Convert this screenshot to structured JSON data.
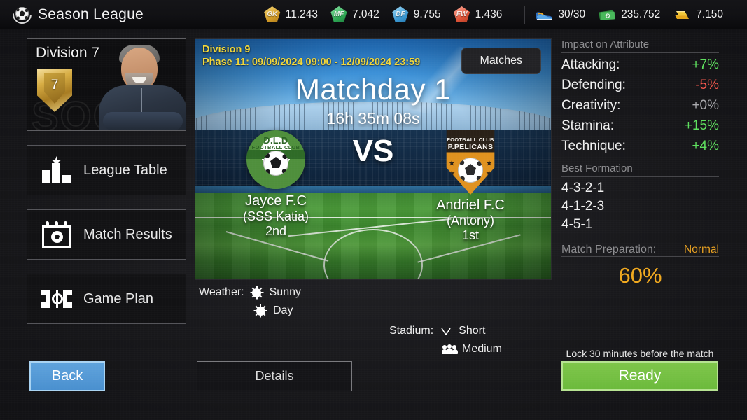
{
  "header": {
    "title": "Season League",
    "logo_icon": "soccer-ball-laurel-icon",
    "currencies": [
      {
        "icon": "gk-token-icon",
        "code": "GK",
        "value": "11.243"
      },
      {
        "icon": "mf-token-icon",
        "code": "MF",
        "value": "7.042"
      },
      {
        "icon": "df-token-icon",
        "code": "DF",
        "value": "9.755"
      },
      {
        "icon": "fw-token-icon",
        "code": "FW",
        "value": "1.436"
      },
      {
        "icon": "energy-shoe-icon",
        "code": "",
        "value": "30/30"
      },
      {
        "icon": "cash-icon",
        "code": "",
        "value": "235.752"
      },
      {
        "icon": "gold-bar-icon",
        "code": "",
        "value": "7.150"
      }
    ]
  },
  "sidebar": {
    "division_card": {
      "title": "Division 7",
      "badge_number": "7",
      "watermark": "SOCCER"
    },
    "items": [
      {
        "label": "League Table",
        "icon": "bar-chart-star-icon"
      },
      {
        "label": "Match Results",
        "icon": "calendar-ball-icon"
      },
      {
        "label": "Game Plan",
        "icon": "pitch-icon"
      }
    ]
  },
  "match": {
    "division": "Division 9",
    "phase": "Phase 11: 09/09/2024 09:00 - 12/09/2024 23:59",
    "matches_button": "Matches",
    "matchday": "Matchday 1",
    "countdown": "16h 35m 08s",
    "vs": "VS",
    "home": {
      "name": "Jayce F.C",
      "manager": "(SSS Katia)",
      "rank": "2nd",
      "crest_icon": "home-crest-icon",
      "crest_line1": "D.L.D",
      "crest_line2": "FOOTBALL CLUB"
    },
    "away": {
      "name": "Andriel F.C",
      "manager": "(Antony)",
      "rank": "1st",
      "crest_icon": "away-crest-icon",
      "crest_line1": "FOOTBALL CLUB",
      "crest_line2": "P.PELICANS"
    }
  },
  "conditions": {
    "weather_label": "Weather:",
    "weather_value_1": "Sunny",
    "weather_value_2": "Day",
    "stadium_label": "Stadium:",
    "stadium_value_1": "Short",
    "stadium_value_2": "Medium"
  },
  "right_panel": {
    "impact_title": "Impact on Attribute",
    "attributes": [
      {
        "name": "Attacking:",
        "value": "+7%",
        "tone": "positive"
      },
      {
        "name": "Defending:",
        "value": "-5%",
        "tone": "negative"
      },
      {
        "name": "Creativity:",
        "value": "+0%",
        "tone": "neutral"
      },
      {
        "name": "Stamina:",
        "value": "+15%",
        "tone": "positive"
      },
      {
        "name": "Technique:",
        "value": "+4%",
        "tone": "positive"
      }
    ],
    "formation_title": "Best Formation",
    "formations": [
      "4-3-2-1",
      "4-1-2-3",
      "4-5-1"
    ],
    "prep_label": "Match Preparation:",
    "prep_state": "Normal",
    "prep_percent": "60%"
  },
  "footer": {
    "back_label": "Back",
    "details_label": "Details",
    "lock_note": "Lock 30 minutes before the match",
    "ready_label": "Ready"
  },
  "colors": {
    "accent_yellow": "#f2d73a",
    "positive_green": "#5ee05e",
    "negative_red": "#f2554a",
    "prep_orange": "#f0a81e",
    "ready_green": "#6cba3c",
    "back_blue": "#4a90cf"
  }
}
